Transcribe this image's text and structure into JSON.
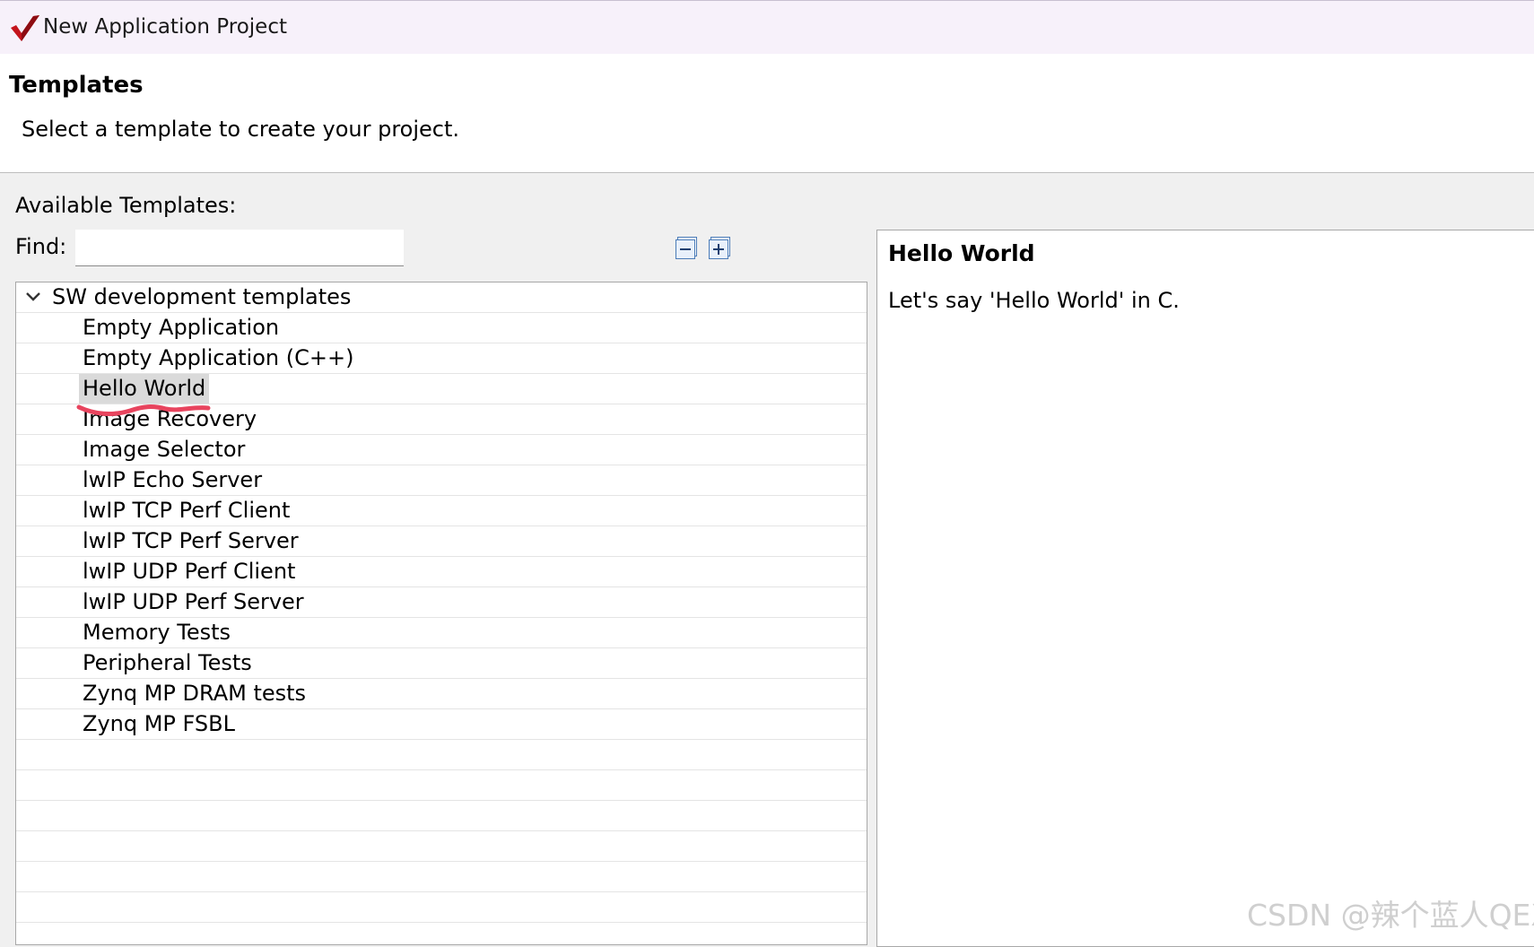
{
  "window": {
    "title": "New Application Project"
  },
  "header": {
    "title": "Templates",
    "description": "Select a template to create your project."
  },
  "templates_panel": {
    "available_label": "Available Templates:",
    "find_label": "Find:",
    "find_value": "",
    "collapse_icon": "collapse-all-icon",
    "expand_icon": "expand-all-icon",
    "group": "SW development templates",
    "items": [
      "Empty Application",
      "Empty Application (C++)",
      "Hello World",
      "Image Recovery",
      "Image Selector",
      "lwIP Echo Server",
      "lwIP TCP Perf Client",
      "lwIP TCP Perf Server",
      "lwIP UDP Perf Client",
      "lwIP UDP Perf Server",
      "Memory Tests",
      "Peripheral Tests",
      "Zynq MP DRAM tests",
      "Zynq MP FSBL"
    ],
    "selected_item": "Hello World"
  },
  "description_panel": {
    "title": "Hello World",
    "text": "Let's say 'Hello World' in C."
  },
  "watermark": "CSDN @辣个蓝人QEX",
  "colors": {
    "titlebar": "#f7f1fa",
    "selection": "#dadada",
    "annotation": "#e8445e",
    "logo": "#c4141c"
  }
}
